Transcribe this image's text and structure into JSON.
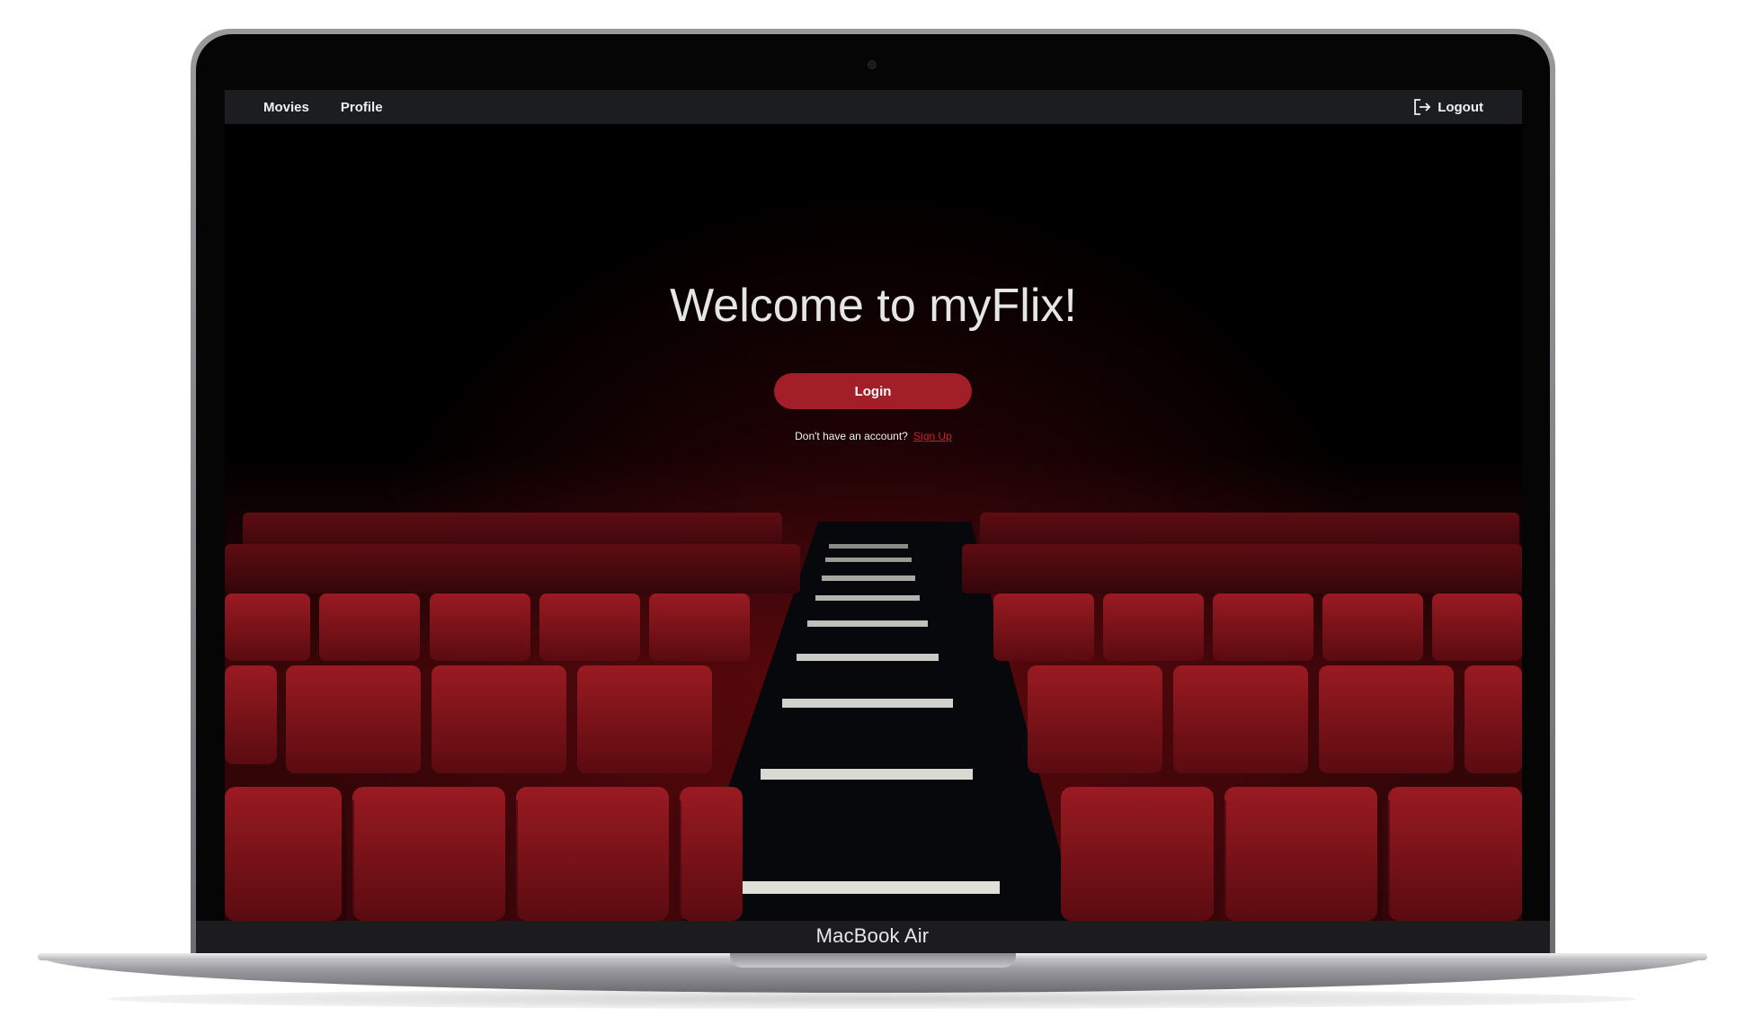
{
  "device": {
    "model_label": "MacBook Air"
  },
  "navbar": {
    "links": [
      {
        "label": "Movies"
      },
      {
        "label": "Profile"
      }
    ],
    "logout_label": "Logout",
    "logout_icon": "logout-icon"
  },
  "hero": {
    "title": "Welcome to myFlix!",
    "login_label": "Login",
    "signup_prompt": "Don't have an account?",
    "signup_link": "Sign Up"
  },
  "colors": {
    "navbar_bg": "#1c1d20",
    "accent": "#a31f27",
    "link": "#c0282f",
    "seat_red": "#7a1218"
  }
}
